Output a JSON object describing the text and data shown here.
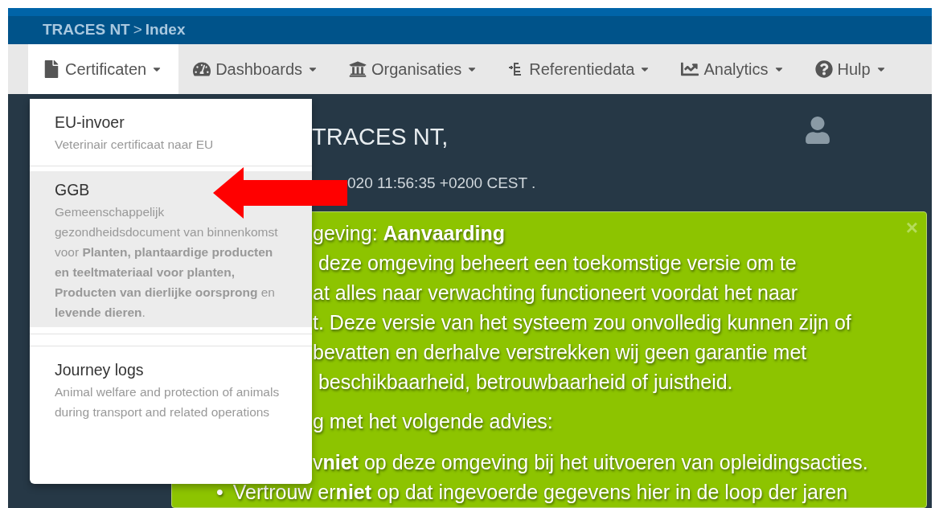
{
  "breadcrumb": {
    "root": "TRACES NT",
    "separator": ">",
    "page": "Index"
  },
  "nav": [
    {
      "label": "Certificaten",
      "selected": true
    },
    {
      "label": "Dashboards",
      "selected": false
    },
    {
      "label": "Organisaties",
      "selected": false
    },
    {
      "label": "Referentiedata",
      "selected": false
    },
    {
      "label": "Analytics",
      "selected": false
    },
    {
      "label": "Hulp",
      "selected": false
    }
  ],
  "dropdown": [
    {
      "title": "EU-invoer",
      "description": "Veterinair certificaat naar EU",
      "selected": false
    },
    {
      "title": "GGB",
      "description": "Gemeenschappelijk gezondheidsdocument van binnenkomst voor **Planten, plantaardige producten en teeltmateriaal voor planten, Producten van dierlijke oorsprong** en **levende dieren**.",
      "selected": true
    },
    {
      "title": "Journey logs",
      "description": "Animal welfare and protection of animals during transport and related operations",
      "selected": false
    }
  ],
  "welcome": {
    "heading": "TRACES NT,",
    "timestamp": "020 11:56:35 +0200 CEST ."
  },
  "alert": {
    "title": "geving: **Aanvaarding**",
    "close": "×",
    "lines": [
      " deze omgeving beheert een toekomstige versie om te",
      "at alles naar verwachting functioneert voordat het naar",
      "t. Deze versie van het systeem zou onvolledig kunnen zijn of",
      "bevatten en derhalve verstrekken wij geen garantie met",
      " beschikbaarheid, betrouwbaarheid of juistheid."
    ],
    "advice": "g met het volgende advies:",
    "bullets": [
      {
        "kind": "partial",
        "text": "v**niet** op deze omgeving bij het uitvoeren van opleidingsacties."
      },
      {
        "kind": "full",
        "marker": "•",
        "text": "Vertrouw er**niet** op dat ingevoerde gegevens hier in de loop der jaren"
      }
    ]
  }
}
